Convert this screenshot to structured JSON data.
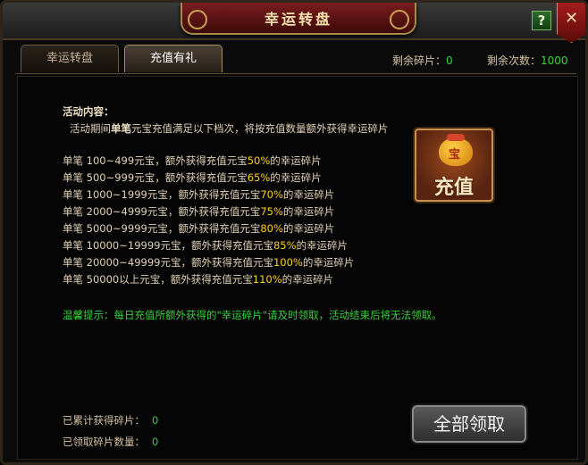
{
  "window": {
    "title": "幸运转盘",
    "help_label": "?",
    "close_label": "✕"
  },
  "tabs": [
    {
      "label": "幸运转盘",
      "active": false
    },
    {
      "label": "充值有礼",
      "active": true
    }
  ],
  "stats": {
    "fragments_label": "剩余碎片：",
    "fragments_value": "0",
    "spins_label": "剩余次数：",
    "spins_value": "1000"
  },
  "content": {
    "heading": "活动内容：",
    "intro_a": "活动期间",
    "intro_b": "单笔",
    "intro_c": "元宝充值满足以下档次，将按充值数量额外获得幸运碎片",
    "tiers": [
      {
        "prefix": "单笔 100~499元宝，额外获得充值元宝",
        "percent": "50%",
        "suffix": "的幸运碎片"
      },
      {
        "prefix": "单笔 500~999元宝，额外获得充值元宝",
        "percent": "65%",
        "suffix": "的幸运碎片"
      },
      {
        "prefix": "单笔 1000~1999元宝，额外获得充值元宝",
        "percent": "70%",
        "suffix": "的幸运碎片"
      },
      {
        "prefix": "单笔 2000~4999元宝，额外获得充值元宝",
        "percent": "75%",
        "suffix": "的幸运碎片"
      },
      {
        "prefix": "单笔 5000~9999元宝，额外获得充值元宝",
        "percent": "80%",
        "suffix": "的幸运碎片"
      },
      {
        "prefix": "单笔 10000~19999元宝，额外获得充值元宝",
        "percent": "85%",
        "suffix": "的幸运碎片"
      },
      {
        "prefix": "单笔 20000~49999元宝，额外获得充值元宝",
        "percent": "100%",
        "suffix": "的幸运碎片"
      },
      {
        "prefix": "单笔 50000以上元宝，额外获得充值元宝",
        "percent": "110%",
        "suffix": "的幸运碎片"
      }
    ],
    "tip": "温馨提示：每日充值所额外获得的\"幸运碎片\"请及时领取，活动结束后将无法领取。"
  },
  "recharge_button": {
    "label": "充值",
    "bag_char": "宝"
  },
  "footer": {
    "accumulated_label": "已累计获得碎片：",
    "accumulated_value": "0",
    "claimed_label": "已领取碎片数量：",
    "claimed_value": "0"
  },
  "collect_button": {
    "label": "全部领取"
  },
  "colors": {
    "highlight": "#ffd11a",
    "tip": "#38d13e",
    "value": "#35d43a"
  }
}
